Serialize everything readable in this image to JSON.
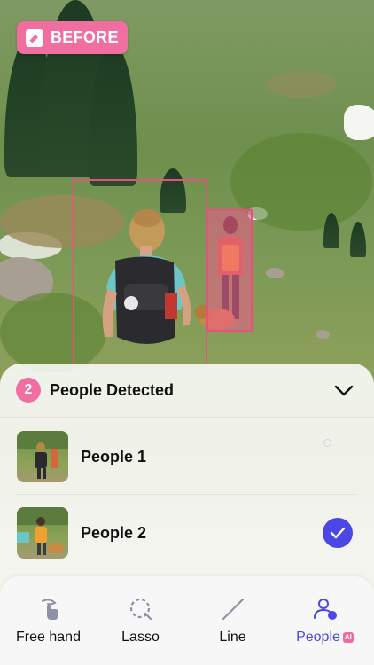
{
  "badge": {
    "label": "BEFORE",
    "color": "#f06ea0"
  },
  "panel": {
    "count": "2",
    "title": "People Detected",
    "items": [
      {
        "label": "People 1",
        "selected": false
      },
      {
        "label": "People 2",
        "selected": true
      }
    ]
  },
  "toolbar": {
    "tools": [
      {
        "label": "Free hand",
        "icon": "finger-draw-icon",
        "active": false
      },
      {
        "label": "Lasso",
        "icon": "lasso-icon",
        "active": false
      },
      {
        "label": "Line",
        "icon": "line-icon",
        "active": false
      },
      {
        "label": "People",
        "icon": "person-ai-icon",
        "active": true,
        "tag": "AI"
      }
    ]
  },
  "colors": {
    "accent": "#4a47e6",
    "pink": "#f06ea0"
  }
}
